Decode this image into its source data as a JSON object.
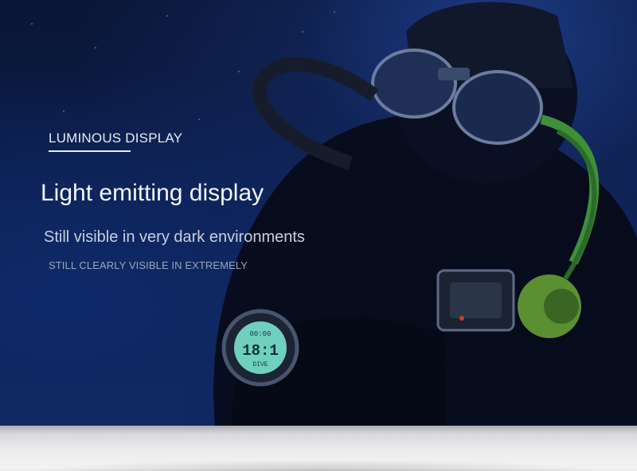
{
  "hero": {
    "kicker": "LUMINOUS DISPLAY",
    "headline": "Light emitting display",
    "subtitle": "Still visible in very dark environments",
    "caption": "STILL CLEARLY VISIBLE IN EXTREMELY"
  },
  "watch_screen": {
    "top_row": "00:00",
    "middle": "18:1",
    "bottom_row": "DIVE"
  },
  "colors": {
    "background": "#0c1d4a",
    "text": "#f3f5f9",
    "accent_green": "#5fb04a",
    "watch_screen": "#6fd0c0"
  }
}
